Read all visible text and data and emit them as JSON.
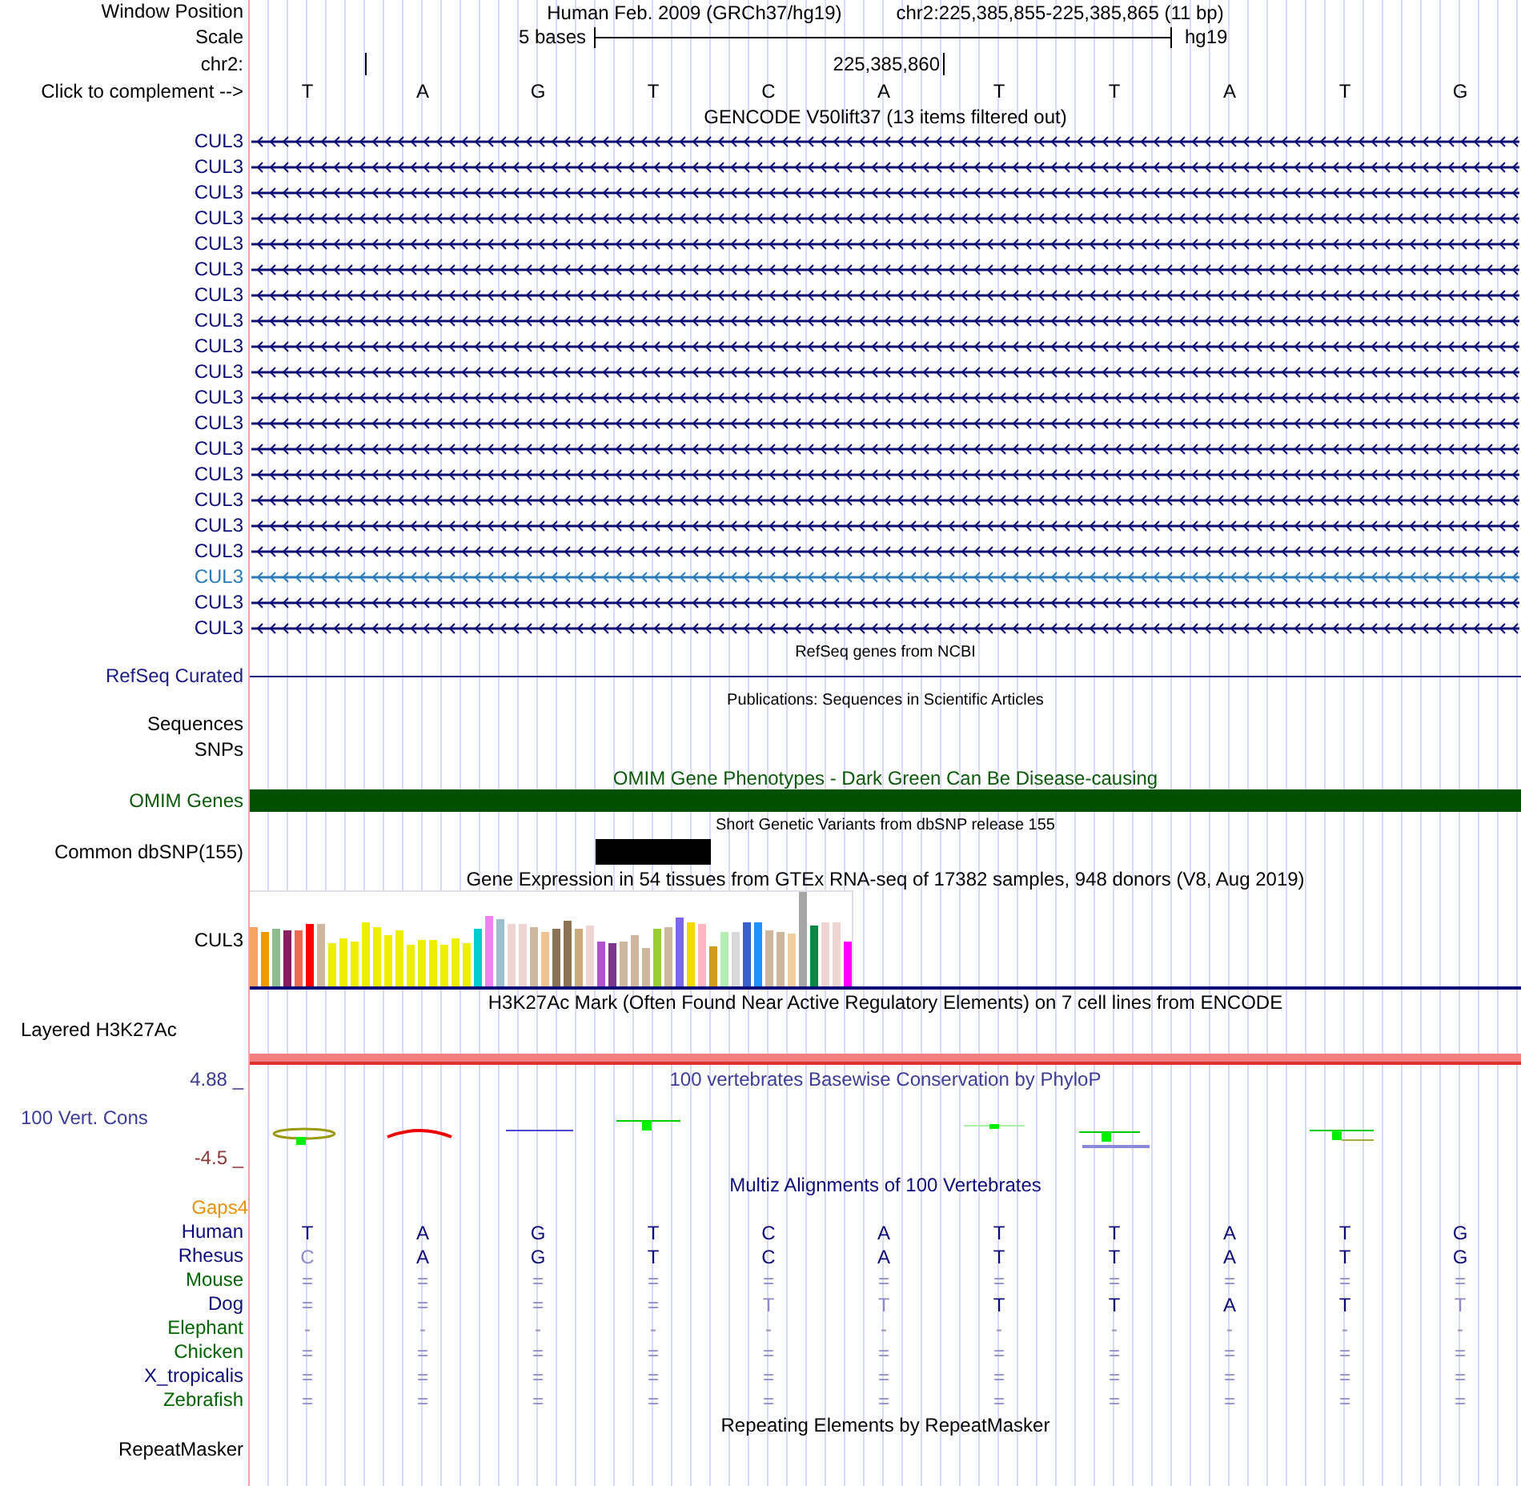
{
  "position": {
    "label": "Window Position",
    "assembly": "Human Feb. 2009 (GRCh37/hg19)",
    "range": "chr2:225,385,855-225,385,865 (11 bp)"
  },
  "scale": {
    "label": "Scale",
    "length": "5 bases",
    "db": "hg19"
  },
  "ruler": {
    "label": "chr2:",
    "coordinate": "225,385,860"
  },
  "sequence": {
    "label": "Click to complement -->",
    "bases": [
      "T",
      "A",
      "G",
      "T",
      "C",
      "A",
      "T",
      "T",
      "A",
      "T",
      "G"
    ]
  },
  "gencode": {
    "title": "GENCODE V50lift37 (13 items filtered out)",
    "items": [
      {
        "name": "CUL3",
        "color": "#0c0c78"
      },
      {
        "name": "CUL3",
        "color": "#0c0c78"
      },
      {
        "name": "CUL3",
        "color": "#0c0c78"
      },
      {
        "name": "CUL3",
        "color": "#0c0c78"
      },
      {
        "name": "CUL3",
        "color": "#0c0c78"
      },
      {
        "name": "CUL3",
        "color": "#0c0c78"
      },
      {
        "name": "CUL3",
        "color": "#0c0c78"
      },
      {
        "name": "CUL3",
        "color": "#0c0c78"
      },
      {
        "name": "CUL3",
        "color": "#0c0c78"
      },
      {
        "name": "CUL3",
        "color": "#0c0c78"
      },
      {
        "name": "CUL3",
        "color": "#0c0c78"
      },
      {
        "name": "CUL3",
        "color": "#0c0c78"
      },
      {
        "name": "CUL3",
        "color": "#0c0c78"
      },
      {
        "name": "CUL3",
        "color": "#0c0c78"
      },
      {
        "name": "CUL3",
        "color": "#0c0c78"
      },
      {
        "name": "CUL3",
        "color": "#0c0c78"
      },
      {
        "name": "CUL3",
        "color": "#0c0c78"
      },
      {
        "name": "CUL3",
        "color": "#2a7ab9"
      },
      {
        "name": "CUL3",
        "color": "#0c0c78"
      },
      {
        "name": "CUL3",
        "color": "#0c0c78"
      }
    ]
  },
  "refseq": {
    "title": "RefSeq genes from NCBI",
    "label": "RefSeq Curated"
  },
  "publications": {
    "title": "Publications: Sequences in Scientific Articles",
    "labels": [
      "Sequences",
      "SNPs"
    ]
  },
  "omim": {
    "title": "OMIM Gene Phenotypes - Dark Green Can Be Disease-causing",
    "label": "OMIM Genes"
  },
  "dbsnp": {
    "title": "Short Genetic Variants from dbSNP release 155",
    "label": "Common dbSNP(155)"
  },
  "gtex": {
    "title": "Gene Expression in 54 tissues from GTEx RNA-seq of 17382 samples, 948 donors (V8, Aug 2019)",
    "label": "CUL3"
  },
  "h3k27ac": {
    "title": "H3K27Ac Mark (Often Found Near Active Regulatory Elements) on 7 cell lines from ENCODE",
    "label": "Layered H3K27Ac"
  },
  "conservation": {
    "title": "100 vertebrates Basewise Conservation by PhyloP",
    "label": "100 Vert. Cons",
    "scale_max": "4.88 _",
    "scale_min": "-4.5 _"
  },
  "multiz": {
    "title": "Multiz Alignments of 100 Vertebrates",
    "gaps_label": "Gaps4",
    "species": [
      {
        "name": "Human",
        "color": "#0c0c78",
        "bases": [
          {
            "base": "T",
            "faint": false
          },
          {
            "base": "A",
            "faint": false
          },
          {
            "base": "G",
            "faint": false
          },
          {
            "base": "T",
            "faint": false
          },
          {
            "base": "C",
            "faint": false
          },
          {
            "base": "A",
            "faint": false
          },
          {
            "base": "T",
            "faint": false
          },
          {
            "base": "T",
            "faint": false
          },
          {
            "base": "A",
            "faint": false
          },
          {
            "base": "T",
            "faint": false
          },
          {
            "base": "G",
            "faint": false
          }
        ]
      },
      {
        "name": "Rhesus",
        "color": "#0c0c78",
        "bases": [
          {
            "base": "C",
            "faint": true
          },
          {
            "base": "A",
            "faint": false
          },
          {
            "base": "G",
            "faint": false
          },
          {
            "base": "T",
            "faint": false
          },
          {
            "base": "C",
            "faint": false
          },
          {
            "base": "A",
            "faint": false
          },
          {
            "base": "T",
            "faint": false
          },
          {
            "base": "T",
            "faint": false
          },
          {
            "base": "A",
            "faint": false
          },
          {
            "base": "T",
            "faint": false
          },
          {
            "base": "G",
            "faint": false
          }
        ]
      },
      {
        "name": "Mouse",
        "color": "#006400",
        "bases": [
          {
            "base": "=",
            "faint": true
          },
          {
            "base": "=",
            "faint": true
          },
          {
            "base": "=",
            "faint": true
          },
          {
            "base": "=",
            "faint": true
          },
          {
            "base": "=",
            "faint": true
          },
          {
            "base": "=",
            "faint": true
          },
          {
            "base": "=",
            "faint": true
          },
          {
            "base": "=",
            "faint": true
          },
          {
            "base": "=",
            "faint": true
          },
          {
            "base": "=",
            "faint": true
          },
          {
            "base": "=",
            "faint": true
          }
        ]
      },
      {
        "name": "Dog",
        "color": "#0c0c78",
        "bases": [
          {
            "base": "=",
            "faint": true
          },
          {
            "base": "=",
            "faint": true
          },
          {
            "base": "=",
            "faint": true
          },
          {
            "base": "=",
            "faint": true
          },
          {
            "base": "T",
            "faint": true
          },
          {
            "base": "T",
            "faint": true
          },
          {
            "base": "T",
            "faint": false
          },
          {
            "base": "T",
            "faint": false
          },
          {
            "base": "A",
            "faint": false
          },
          {
            "base": "T",
            "faint": false
          },
          {
            "base": "T",
            "faint": true
          }
        ]
      },
      {
        "name": "Elephant",
        "color": "#006400",
        "bases": [
          {
            "base": "-",
            "faint": true
          },
          {
            "base": "-",
            "faint": true
          },
          {
            "base": "-",
            "faint": true
          },
          {
            "base": "-",
            "faint": true
          },
          {
            "base": "-",
            "faint": true
          },
          {
            "base": "-",
            "faint": true
          },
          {
            "base": "-",
            "faint": true
          },
          {
            "base": "-",
            "faint": true
          },
          {
            "base": "-",
            "faint": true
          },
          {
            "base": "-",
            "faint": true
          },
          {
            "base": "-",
            "faint": true
          }
        ]
      },
      {
        "name": "Chicken",
        "color": "#006400",
        "bases": [
          {
            "base": "=",
            "faint": true
          },
          {
            "base": "=",
            "faint": true
          },
          {
            "base": "=",
            "faint": true
          },
          {
            "base": "=",
            "faint": true
          },
          {
            "base": "=",
            "faint": true
          },
          {
            "base": "=",
            "faint": true
          },
          {
            "base": "=",
            "faint": true
          },
          {
            "base": "=",
            "faint": true
          },
          {
            "base": "=",
            "faint": true
          },
          {
            "base": "=",
            "faint": true
          },
          {
            "base": "=",
            "faint": true
          }
        ]
      },
      {
        "name": "X_tropicalis",
        "color": "#0c0c78",
        "bases": [
          {
            "base": "=",
            "faint": true
          },
          {
            "base": "=",
            "faint": true
          },
          {
            "base": "=",
            "faint": true
          },
          {
            "base": "=",
            "faint": true
          },
          {
            "base": "=",
            "faint": true
          },
          {
            "base": "=",
            "faint": true
          },
          {
            "base": "=",
            "faint": true
          },
          {
            "base": "=",
            "faint": true
          },
          {
            "base": "=",
            "faint": true
          },
          {
            "base": "=",
            "faint": true
          },
          {
            "base": "=",
            "faint": true
          }
        ]
      },
      {
        "name": "Zebrafish",
        "color": "#006400",
        "bases": [
          {
            "base": "=",
            "faint": true
          },
          {
            "base": "=",
            "faint": true
          },
          {
            "base": "=",
            "faint": true
          },
          {
            "base": "=",
            "faint": true
          },
          {
            "base": "=",
            "faint": true
          },
          {
            "base": "=",
            "faint": true
          },
          {
            "base": "=",
            "faint": true
          },
          {
            "base": "=",
            "faint": true
          },
          {
            "base": "=",
            "faint": true
          },
          {
            "base": "=",
            "faint": true
          },
          {
            "base": "=",
            "faint": true
          }
        ]
      }
    ]
  },
  "repeatmasker": {
    "title": "Repeating Elements by RepeatMasker",
    "label": "RepeatMasker"
  }
}
